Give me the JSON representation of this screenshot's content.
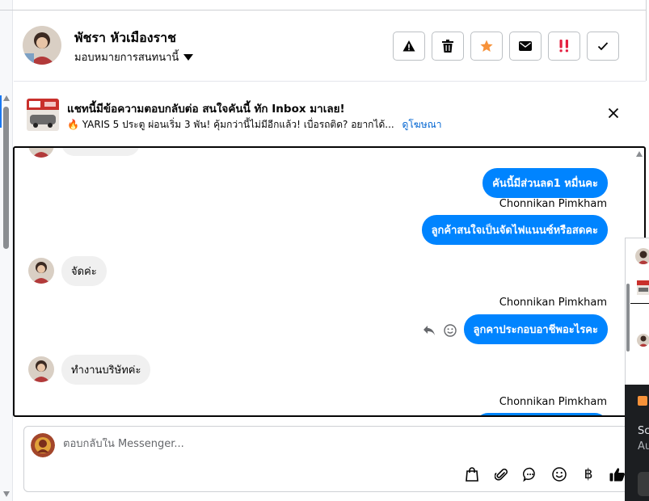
{
  "header": {
    "contact_name": "พัชรา หัวเมืองราช",
    "assign_label": "มอบหมายการสนทนานี้",
    "actions": [
      {
        "name": "report-button",
        "icon": "warning-icon"
      },
      {
        "name": "delete-button",
        "icon": "trash-icon"
      },
      {
        "name": "star-button",
        "icon": "star-icon"
      },
      {
        "name": "mark-unread-button",
        "icon": "envelope-icon"
      },
      {
        "name": "priority-button",
        "icon": "exclamation-icon"
      },
      {
        "name": "mark-done-button",
        "icon": "check-icon"
      }
    ]
  },
  "ad": {
    "title": "แชทนี้มีข้อความตอบกลับต่อ สนใจคันนี้ ทัก Inbox มาเลย!",
    "subtitle": "🔥 YARIS 5 ประตู ผ่อนเริ่ม 3 พัน! คุ้มกว่านี้ไม่มีอีกแล้ว! เบื่อรถติด? อยากได้...",
    "link": "ดูโฆษณา"
  },
  "messages": {
    "out1": "คันนี้มีส่วนลด1 หมื่นคะ",
    "sender1": "Chonnikan Pimkham",
    "out2": "ลูกค้าสนใจเป็นจัดไฟแนนซ์หรือสดคะ",
    "in1": "จัดค่ะ",
    "sender2": "Chonnikan Pimkham",
    "out3": "ลูกคาประกอบอาชีพอะไรคะ",
    "in2": "ทำงานบริษัทค่ะ",
    "sender3": "Chonnikan Pimkham"
  },
  "composer": {
    "placeholder": "ตอบกลับใน Messenger...",
    "currency_symbol": "฿"
  },
  "overlay": {
    "line1": "Sc",
    "line2": "Au"
  },
  "colors": {
    "outgoing_bubble": "#0084ff",
    "incoming_bubble": "#f0f0f0",
    "link": "#0064d1",
    "star": "#f7923a",
    "priority": "#e41e3f"
  }
}
